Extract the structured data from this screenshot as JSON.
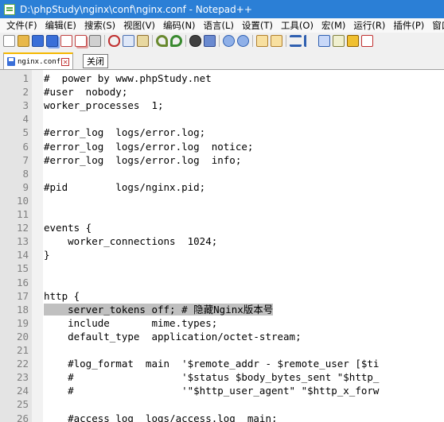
{
  "window": {
    "title": "D:\\phpStudy\\nginx\\conf\\nginx.conf - Notepad++"
  },
  "menu": [
    "文件(F)",
    "编辑(E)",
    "搜索(S)",
    "视图(V)",
    "编码(N)",
    "语言(L)",
    "设置(T)",
    "工具(O)",
    "宏(M)",
    "运行(R)",
    "插件(P)",
    "窗口"
  ],
  "toolbar_icons": [
    "new-file-icon",
    "open-file-icon",
    "save-icon",
    "save-all-icon",
    "close-icon",
    "close-all-icon",
    "print-icon",
    "cut-icon",
    "copy-icon",
    "paste-icon",
    "undo-icon",
    "redo-icon",
    "find-icon",
    "replace-icon",
    "zoom-in-icon",
    "zoom-out-icon",
    "sync-vertical-icon",
    "sync-horizontal-icon",
    "word-wrap-icon",
    "show-all-chars-icon",
    "indent-guide-icon",
    "doc-map-icon",
    "function-list-icon",
    "folder-workspace-icon"
  ],
  "tab": {
    "name": "nginx.conf",
    "tooltip": "关闭"
  },
  "editor": {
    "lines": [
      {
        "n": "1",
        "text": "#  power by www.phpStudy.net"
      },
      {
        "n": "2",
        "text": "#user  nobody;"
      },
      {
        "n": "3",
        "text": "worker_processes  1;"
      },
      {
        "n": "4",
        "text": ""
      },
      {
        "n": "5",
        "text": "#error_log  logs/error.log;"
      },
      {
        "n": "6",
        "text": "#error_log  logs/error.log  notice;"
      },
      {
        "n": "7",
        "text": "#error_log  logs/error.log  info;"
      },
      {
        "n": "8",
        "text": ""
      },
      {
        "n": "9",
        "text": "#pid        logs/nginx.pid;"
      },
      {
        "n": "10",
        "text": ""
      },
      {
        "n": "11",
        "text": ""
      },
      {
        "n": "12",
        "text": "events {"
      },
      {
        "n": "13",
        "text": "    worker_connections  1024;"
      },
      {
        "n": "14",
        "text": "}"
      },
      {
        "n": "15",
        "text": ""
      },
      {
        "n": "16",
        "text": ""
      },
      {
        "n": "17",
        "text": "http {"
      },
      {
        "n": "18",
        "text": "    server_tokens off; # 隐藏Nginx版本号"
      },
      {
        "n": "19",
        "text": "    include       mime.types;"
      },
      {
        "n": "20",
        "text": "    default_type  application/octet-stream;"
      },
      {
        "n": "21",
        "text": ""
      },
      {
        "n": "22",
        "text": "    #log_format  main  '$remote_addr - $remote_user [$ti"
      },
      {
        "n": "23",
        "text": "    #                  '$status $body_bytes_sent \"$http_"
      },
      {
        "n": "24",
        "text": "    #                  '\"$http_user_agent\" \"$http_x_forw"
      },
      {
        "n": "25",
        "text": ""
      },
      {
        "n": "26",
        "text": "    #access_log  logs/access.log  main;"
      }
    ]
  }
}
